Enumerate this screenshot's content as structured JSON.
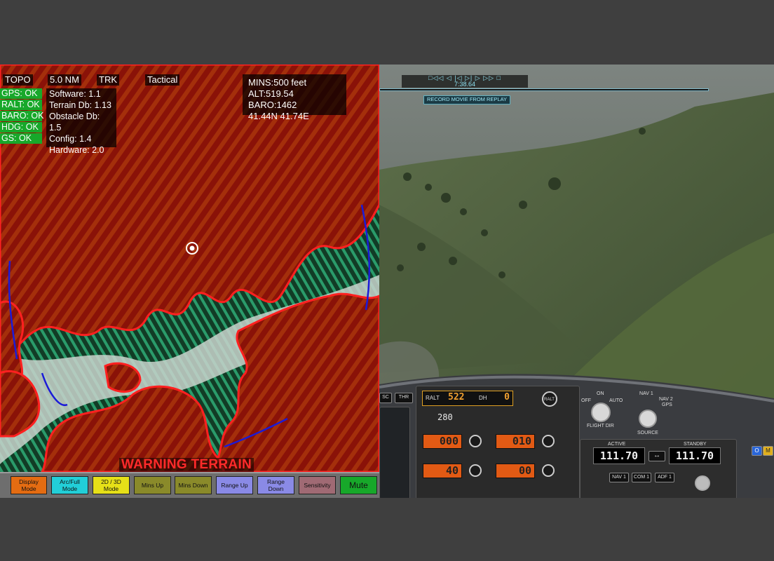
{
  "map": {
    "top_labels": {
      "topo": "TOPO",
      "range": "5.0 NM",
      "trk": "TRK",
      "tactical": "Tactical"
    },
    "info": {
      "mins": "MINS:500 feet",
      "alt_baro": "ALT:519.54 BARO:1462",
      "coords": "41.44N 41.74E"
    },
    "status": [
      "GPS: OK",
      "RALT: OK",
      "BARO: OK",
      "HDG: OK",
      "GS: OK"
    ],
    "versions": [
      "Software: 1.1",
      "Terrain Db: 1.13",
      "Obstacle Db: 1.5",
      "Config: 1.4",
      "Hardware: 2.0"
    ],
    "warning": "WARNING TERRAIN",
    "buttons": [
      {
        "l1": "Display",
        "l2": "Mode",
        "color": "#e46c12"
      },
      {
        "l1": "Arc/Full",
        "l2": "Mode",
        "color": "#22cfd8"
      },
      {
        "l1": "2D / 3D",
        "l2": "Mode",
        "color": "#e6e018"
      },
      {
        "l1": "Mins Up",
        "l2": "",
        "color": "#8a8a2a"
      },
      {
        "l1": "Mins Down",
        "l2": "",
        "color": "#8a8a2a"
      },
      {
        "l1": "Range Up",
        "l2": "",
        "color": "#8a8ae6"
      },
      {
        "l1": "Range",
        "l2": "Down",
        "color": "#8a8ae6"
      },
      {
        "l1": "Sensitivity",
        "l2": "",
        "color": "#a06a74"
      },
      {
        "l1": "Mute",
        "l2": "",
        "color": "#17a82a"
      }
    ],
    "colors": {
      "terrain_red": "#8a1208",
      "terrain_outline": "#ff2020",
      "terrain_green": "#1f7a4c",
      "valley_grey": "#c9d3cc",
      "range_arc": "#1b1bd8"
    }
  },
  "sim": {
    "replay_controls": "□◁◁ ◁ |◁ ▷| ▷ ▷▷ □",
    "replay_time": "7:38.64",
    "record_button": "RECORD MOVIE FROM REPLAY",
    "cockpit": {
      "sc": "SC",
      "thr": "THR",
      "ralt_label": "RALT",
      "ralt_value": "522",
      "dh_label": "DH",
      "dh_value": "0",
      "ralt_knob": "RALT",
      "value_280": "280",
      "disp1": "000",
      "disp2": "010",
      "disp3": "40",
      "disp4": "00",
      "flight_dir": {
        "off": "OFF",
        "on": "ON",
        "auto": "AUTO",
        "label": "FLIGHT DIR"
      },
      "source": {
        "nav1": "NAV 1",
        "nav2": "NAV 2",
        "gps": "GPS",
        "label": "SOURCE"
      },
      "radio": {
        "active_label": "ACTIVE",
        "standby_label": "STANDBY",
        "active_freq": "111.70",
        "standby_freq": "111.70",
        "swap": "↔"
      },
      "select": [
        "NAV 1",
        "COM 1",
        "ADF 1"
      ],
      "side_icons": [
        "O",
        "M"
      ]
    }
  }
}
